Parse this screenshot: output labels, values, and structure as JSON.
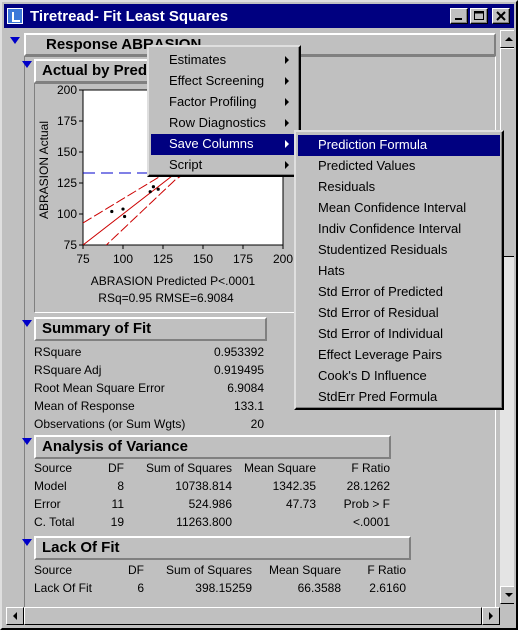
{
  "window": {
    "title": "Tiretread- Fit Least Squares",
    "buttons": {
      "minimize": "minimize-icon",
      "maximize": "maximize-icon",
      "close": "close-icon"
    }
  },
  "response_header": "Response ABRASION",
  "actual_by_predicted": {
    "header": "Actual by Pred",
    "caption": "ABRASION Predicted P<.0001",
    "stats": "RSq=0.95 RMSE=6.9084"
  },
  "summary_of_fit": {
    "header": "Summary of Fit",
    "rows": [
      {
        "label": "RSquare",
        "value": "0.953392"
      },
      {
        "label": "RSquare Adj",
        "value": "0.919495"
      },
      {
        "label": "Root Mean Square Error",
        "value": "6.9084"
      },
      {
        "label": "Mean of Response",
        "value": "133.1"
      },
      {
        "label": "Observations (or Sum Wgts)",
        "value": "20"
      }
    ]
  },
  "analysis_of_variance": {
    "header": "Analysis of Variance",
    "columns": [
      "Source",
      "DF",
      "Sum of Squares",
      "Mean Square",
      "F Ratio"
    ],
    "rows": [
      [
        "Model",
        "8",
        "10738.814",
        "1342.35",
        "28.1262"
      ],
      [
        "Error",
        "11",
        "524.986",
        "47.73",
        "Prob > F"
      ],
      [
        "C. Total",
        "19",
        "11263.800",
        "",
        "<.0001"
      ]
    ]
  },
  "lack_of_fit": {
    "header": "Lack Of Fit",
    "columns": [
      "Source",
      "DF",
      "Sum of Squares",
      "Mean Square",
      "F Ratio"
    ],
    "rows": [
      [
        "Lack Of Fit",
        "6",
        "398.15259",
        "66.3588",
        "2.6160"
      ]
    ]
  },
  "context_menu": {
    "items": [
      {
        "label": "Estimates",
        "submenu": true
      },
      {
        "label": "Effect Screening",
        "submenu": true
      },
      {
        "label": "Factor Profiling",
        "submenu": true
      },
      {
        "label": "Row Diagnostics",
        "submenu": true
      },
      {
        "label": "Save Columns",
        "submenu": true,
        "selected": true
      },
      {
        "label": "Script",
        "submenu": true
      }
    ]
  },
  "submenu": {
    "items": [
      {
        "label": "Prediction Formula",
        "selected": true
      },
      {
        "label": "Predicted Values"
      },
      {
        "label": "Residuals"
      },
      {
        "label": "Mean Confidence Interval"
      },
      {
        "label": "Indiv Confidence Interval"
      },
      {
        "label": "Studentized Residuals"
      },
      {
        "label": "Hats"
      },
      {
        "label": "Std Error of Predicted"
      },
      {
        "label": "Std Error of Residual"
      },
      {
        "label": "Std Error of Individual"
      },
      {
        "label": "Effect Leverage Pairs"
      },
      {
        "label": "Cook's D Influence"
      },
      {
        "label": "StdErr Pred Formula"
      }
    ]
  },
  "chart_data": {
    "type": "scatter",
    "xlabel": "ABRASION Predicted P<.0001",
    "ylabel": "ABRASION Actual",
    "xlim": [
      75,
      200
    ],
    "ylim": [
      75,
      200
    ],
    "x_ticks": [
      "75",
      "100",
      "125",
      "150",
      "175",
      "200"
    ],
    "y_ticks": [
      "75",
      "100",
      "125",
      "150",
      "175",
      "200"
    ],
    "mean_line": 133.1,
    "points": [
      {
        "x": 93,
        "y": 102
      },
      {
        "x": 100,
        "y": 104
      },
      {
        "x": 101,
        "y": 98
      },
      {
        "x": 117,
        "y": 118
      },
      {
        "x": 119,
        "y": 122
      },
      {
        "x": 122,
        "y": 120
      }
    ],
    "colors": {
      "fit_line": "#cc0000",
      "confidence_curve": "#cc0000",
      "mean_line": "#0000cc",
      "points": "#000000"
    }
  },
  "colors": {
    "titlebar": "#000080",
    "menu_selection": "#000080",
    "disclosure_blue": "#0000c8",
    "disclosure_red": "#c00000"
  }
}
